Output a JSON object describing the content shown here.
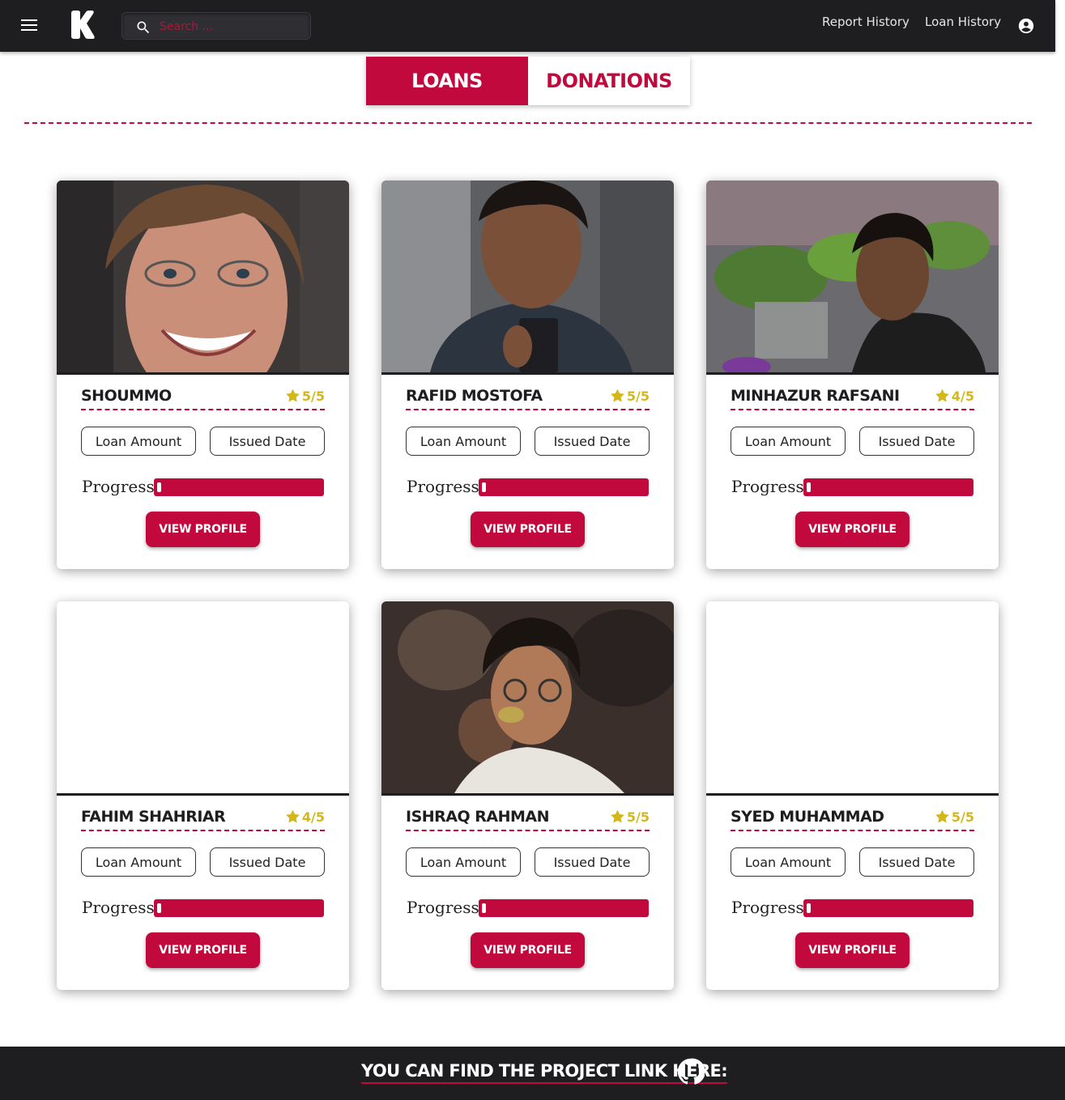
{
  "navbar": {
    "menu_icon": "menu-icon",
    "logo_icon": "k-logo-icon",
    "search": {
      "placeholder": "Search ...",
      "value": "",
      "icon": "search-icon"
    },
    "links": [
      "Report History",
      "Loan History"
    ],
    "account_icon": "account-circle-icon"
  },
  "tabs": [
    {
      "label": "LOANS",
      "active": true
    },
    {
      "label": "DONATIONS",
      "active": false
    }
  ],
  "colors": {
    "accent": "#c2093e",
    "dark": "#1e1e21",
    "star": "#d4b81a"
  },
  "cards": [
    {
      "name": "SHOUMMO",
      "rating": "5/5",
      "loan_amount_label": "Loan Amount",
      "issued_date_label": "Issued Date",
      "progress_label": "Progress :",
      "progress": 0.0,
      "button": "VIEW PROFILE",
      "photo": "portrait-woman-short-hair"
    },
    {
      "name": "RAFID MOSTOFA",
      "rating": "5/5",
      "loan_amount_label": "Loan Amount",
      "issued_date_label": "Issued Date",
      "progress_label": "Progress :",
      "progress": 0.0,
      "button": "VIEW PROFILE",
      "photo": "portrait-man-mirror-selfie"
    },
    {
      "name": "MINHAZUR RAFSANI",
      "rating": "4/5",
      "loan_amount_label": "Loan Amount",
      "issued_date_label": "Issued Date",
      "progress_label": "Progress :",
      "progress": 0.0,
      "button": "VIEW PROFILE",
      "photo": "portrait-man-garden"
    },
    {
      "name": "FAHIM SHAHRIAR",
      "rating": "4/5",
      "loan_amount_label": "Loan Amount",
      "issued_date_label": "Issued Date",
      "progress_label": "Progress :",
      "progress": 0.0,
      "button": "VIEW PROFILE",
      "photo": ""
    },
    {
      "name": "ISHRAQ RAHMAN",
      "rating": "5/5",
      "loan_amount_label": "Loan Amount",
      "issued_date_label": "Issued Date",
      "progress_label": "Progress :",
      "progress": 0.0,
      "button": "VIEW PROFILE",
      "photo": "portrait-man-glasses"
    },
    {
      "name": "SYED MUHAMMAD",
      "rating": "5/5",
      "loan_amount_label": "Loan Amount",
      "issued_date_label": "Issued Date",
      "progress_label": "Progress :",
      "progress": 0.0,
      "button": "VIEW PROFILE",
      "photo": ""
    }
  ],
  "footer": {
    "text": "YOU CAN FIND THE PROJECT LINK HERE:",
    "icon": "github-icon"
  }
}
